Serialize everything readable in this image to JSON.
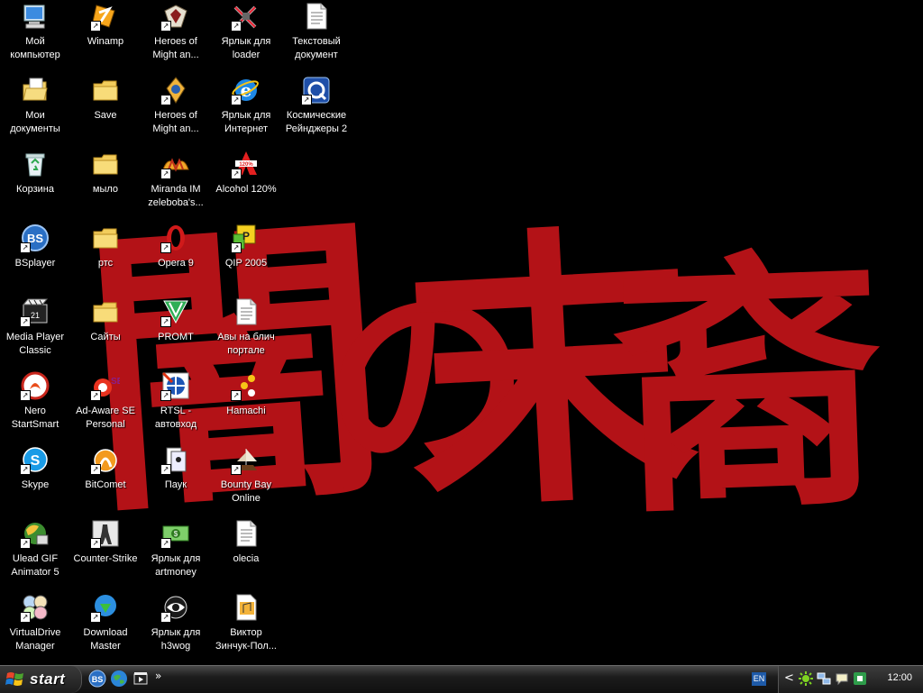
{
  "wallpaper": {
    "glyphs": [
      "闇",
      "の",
      "末",
      "裔"
    ],
    "color": "#b31217"
  },
  "desktop": {
    "icons": [
      {
        "label": "Мой\nкомпьютер",
        "icon": "my-computer-icon",
        "shortcut": false
      },
      {
        "label": "Мои\nдокументы",
        "icon": "my-documents-icon",
        "shortcut": false
      },
      {
        "label": "Корзина",
        "icon": "recycle-bin-icon",
        "shortcut": false
      },
      {
        "label": "BSplayer",
        "icon": "bsplayer-icon",
        "shortcut": true
      },
      {
        "label": "Media Player\nClassic",
        "icon": "media-player-classic-icon",
        "shortcut": true
      },
      {
        "label": "Nero\nStartSmart",
        "icon": "nero-icon",
        "shortcut": true
      },
      {
        "label": "Skype",
        "icon": "skype-icon",
        "shortcut": true
      },
      {
        "label": "Ulead GIF\nAnimator 5",
        "icon": "ulead-gif-animator-icon",
        "shortcut": true
      },
      {
        "label": "VirtualDrive\nManager",
        "icon": "virtualdrive-icon",
        "shortcut": true
      },
      {
        "label": "Winamp",
        "icon": "winamp-icon",
        "shortcut": true
      },
      {
        "label": "Save",
        "icon": "folder-icon",
        "shortcut": false
      },
      {
        "label": "мыло",
        "icon": "folder-icon",
        "shortcut": false
      },
      {
        "label": "ртс",
        "icon": "folder-icon",
        "shortcut": false
      },
      {
        "label": "Сайты",
        "icon": "folder-icon",
        "shortcut": false
      },
      {
        "label": "Ad-Aware SE\nPersonal",
        "icon": "ad-aware-icon",
        "shortcut": true
      },
      {
        "label": "BitComet",
        "icon": "bitcomet-icon",
        "shortcut": true
      },
      {
        "label": "Counter-Strike",
        "icon": "counter-strike-icon",
        "shortcut": true
      },
      {
        "label": "Download\nMaster",
        "icon": "download-master-icon",
        "shortcut": true
      },
      {
        "label": "Heroes of\nMight an...",
        "icon": "heroes-icon",
        "shortcut": true
      },
      {
        "label": "Heroes of\nMight an...",
        "icon": "heroes-4-icon",
        "shortcut": true
      },
      {
        "label": "Miranda IM\nzeleboba's...",
        "icon": "miranda-icon",
        "shortcut": true
      },
      {
        "label": "Opera 9",
        "icon": "opera-icon",
        "shortcut": true
      },
      {
        "label": "PROMT",
        "icon": "promt-icon",
        "shortcut": true
      },
      {
        "label": "RTSL -\nавтовход",
        "icon": "rtsl-icon",
        "shortcut": true
      },
      {
        "label": "Паук",
        "icon": "spider-solitaire-icon",
        "shortcut": true
      },
      {
        "label": "Ярлык для\nartmoney",
        "icon": "artmoney-icon",
        "shortcut": true
      },
      {
        "label": "Ярлык для\nh3wog",
        "icon": "h3wog-icon",
        "shortcut": true
      },
      {
        "label": "Ярлык для\nloader",
        "icon": "loader-icon",
        "shortcut": true
      },
      {
        "label": "Ярлык для\nИнтернет",
        "icon": "internet-explorer-icon",
        "shortcut": true
      },
      {
        "label": "Alcohol 120%",
        "icon": "alcohol-icon",
        "shortcut": true
      },
      {
        "label": "QIP 2005",
        "icon": "qip-icon",
        "shortcut": true
      },
      {
        "label": "Авы на блич\nпортале",
        "icon": "text-document-icon",
        "shortcut": false
      },
      {
        "label": "Hamachi",
        "icon": "hamachi-icon",
        "shortcut": true
      },
      {
        "label": "Bounty Bay\nOnline",
        "icon": "bounty-bay-icon",
        "shortcut": true
      },
      {
        "label": "olecia",
        "icon": "text-document-icon",
        "shortcut": false
      },
      {
        "label": "Виктор\nЗинчук-Пол...",
        "icon": "audio-file-icon",
        "shortcut": false
      },
      {
        "label": "Текстовый\nдокумент",
        "icon": "text-document-icon",
        "shortcut": false
      },
      {
        "label": "Космические\nРейнджеры 2",
        "icon": "space-rangers-icon",
        "shortcut": true
      }
    ]
  },
  "taskbar": {
    "start_label": "start",
    "quick_launch": [
      {
        "icon": "bsplayer-icon"
      },
      {
        "icon": "internet-icon"
      },
      {
        "icon": "media-player-icon"
      }
    ],
    "quick_launch_more": "»",
    "tray": {
      "language": "EN",
      "expand_arrow": "<",
      "icons": [
        "bitcomet-tray-icon",
        "network-icon",
        "messenger-icon",
        "qip-tray-icon"
      ],
      "clock": "12:00"
    }
  }
}
